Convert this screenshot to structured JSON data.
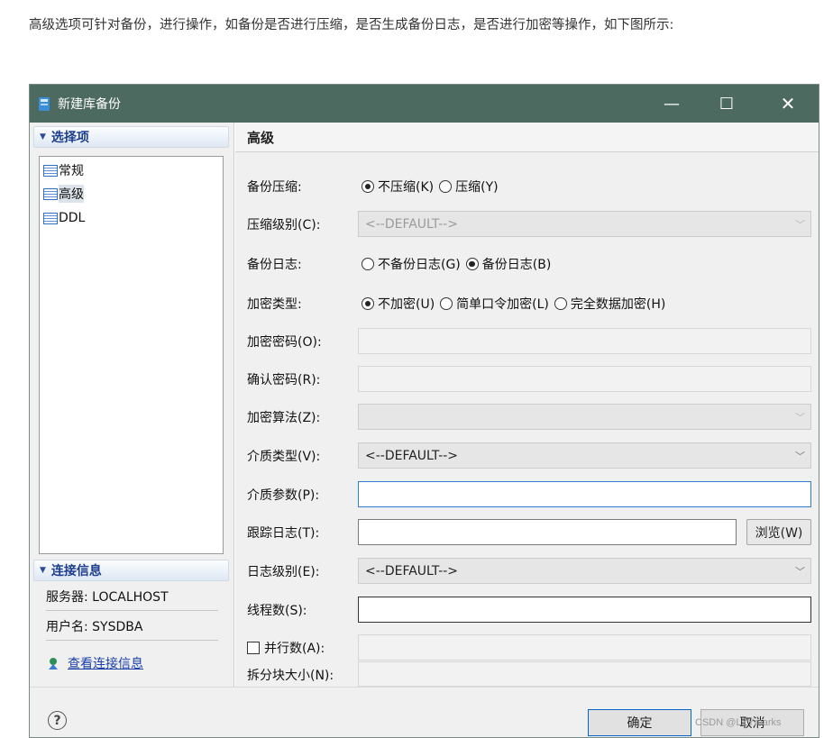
{
  "intro_text": "高级选项可针对备份，进行操作，如备份是否进行压缩，是否生成备份日志，是否进行加密等操作，如下图所示:",
  "window": {
    "title": "新建库备份",
    "minimize_glyph": "—",
    "maximize_glyph": "☐",
    "close_glyph": "✕"
  },
  "left": {
    "options_header": "选择项",
    "tree_items": [
      "常规",
      "高级",
      "DDL"
    ],
    "selected_item": "高级",
    "connection_header": "连接信息",
    "server_label": "服务器: LOCALHOST",
    "user_label": "用户名: SYSDBA",
    "view_link": "查看连接信息"
  },
  "panel": {
    "title": "高级",
    "compress": {
      "label": "备份压缩:",
      "options": [
        "不压缩(K)",
        "压缩(Y)"
      ],
      "selected": "不压缩(K)"
    },
    "compress_level": {
      "label": "压缩级别(C):",
      "value": "<--DEFAULT-->"
    },
    "backup_log": {
      "label": "备份日志:",
      "options": [
        "不备份日志(G)",
        "备份日志(B)"
      ],
      "selected": "备份日志(B)"
    },
    "encrypt_type": {
      "label": "加密类型:",
      "options": [
        "不加密(U)",
        "简单口令加密(L)",
        "完全数据加密(H)"
      ],
      "selected": "不加密(U)"
    },
    "encrypt_password": {
      "label": "加密密码(O):",
      "value": ""
    },
    "confirm_password": {
      "label": "确认密码(R):",
      "value": ""
    },
    "encrypt_algorithm": {
      "label": "加密算法(Z):",
      "value": ""
    },
    "media_type": {
      "label": "介质类型(V):",
      "value": "<--DEFAULT-->"
    },
    "media_params": {
      "label": "介质参数(P):",
      "value": ""
    },
    "trace_log": {
      "label": "跟踪日志(T):",
      "value": "",
      "browse": "浏览(W)"
    },
    "log_level": {
      "label": "日志级别(E):",
      "value": "<--DEFAULT-->"
    },
    "threads": {
      "label": "线程数(S):",
      "value": ""
    },
    "parallel": {
      "label": "并行数(A):",
      "checked": false,
      "value": ""
    },
    "split_size": {
      "label": "拆分块大小(N):",
      "value": ""
    }
  },
  "footer": {
    "help_glyph": "?",
    "ok": "确定",
    "cancel": "取消"
  },
  "watermark": "CSDN @LZYmarks",
  "colors": {
    "titlebar": "#4d6a60",
    "header_text": "#1d3e8c",
    "link": "#1a3fa8",
    "focus_border": "#2f7fcf"
  }
}
